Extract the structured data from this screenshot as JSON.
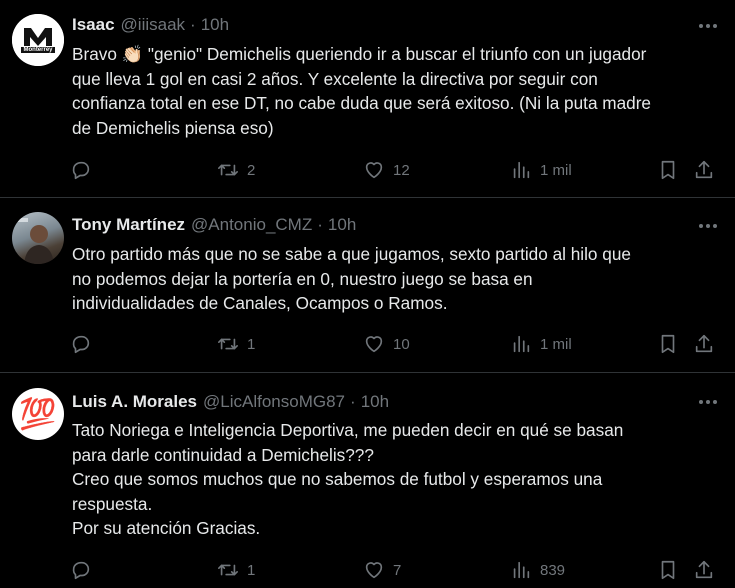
{
  "tweets": [
    {
      "name": "Isaac",
      "handle": "@iiisaak",
      "separator": "·",
      "time": "10h",
      "avatar_label": "Monterrey",
      "text": "Bravo 👏🏻 \"genio\" Demichelis queriendo ir a buscar el triunfo con un jugador\nque lleva 1 gol en casi 2 años. Y excelente la directiva por seguir con\nconfianza total en ese DT, no cabe duda que será exitoso. (Ni la puta madre\nde Demichelis piensa eso)",
      "replies": "",
      "retweets": "2",
      "likes": "12",
      "views": "1 mil"
    },
    {
      "name": "Tony Martínez",
      "handle": "@Antonio_CMZ",
      "separator": "·",
      "time": "10h",
      "text": "Otro partido más que no se sabe a que jugamos, sexto partido al hilo que\nno podemos dejar la portería en 0, nuestro juego se basa en\nindividualidades de Canales, Ocampos o Ramos.",
      "replies": "",
      "retweets": "1",
      "likes": "10",
      "views": "1 mil"
    },
    {
      "name": "Luis A. Morales",
      "handle": "@LicAlfonsoMG87",
      "separator": "·",
      "time": "10h",
      "avatar_emoji": "💯",
      "text": "Tato Noriega e Inteligencia Deportiva, me pueden decir en qué se basan\npara darle continuidad a Demichelis???\nCreo que somos muchos que no sabemos de futbol y esperamos una\nrespuesta.\nPor su atención Gracias.",
      "replies": "",
      "retweets": "1",
      "likes": "7",
      "views": "839"
    }
  ],
  "colors": {
    "background": "#000000",
    "text": "#e7e9ea",
    "muted": "#71767b",
    "divider": "#2f3336"
  }
}
